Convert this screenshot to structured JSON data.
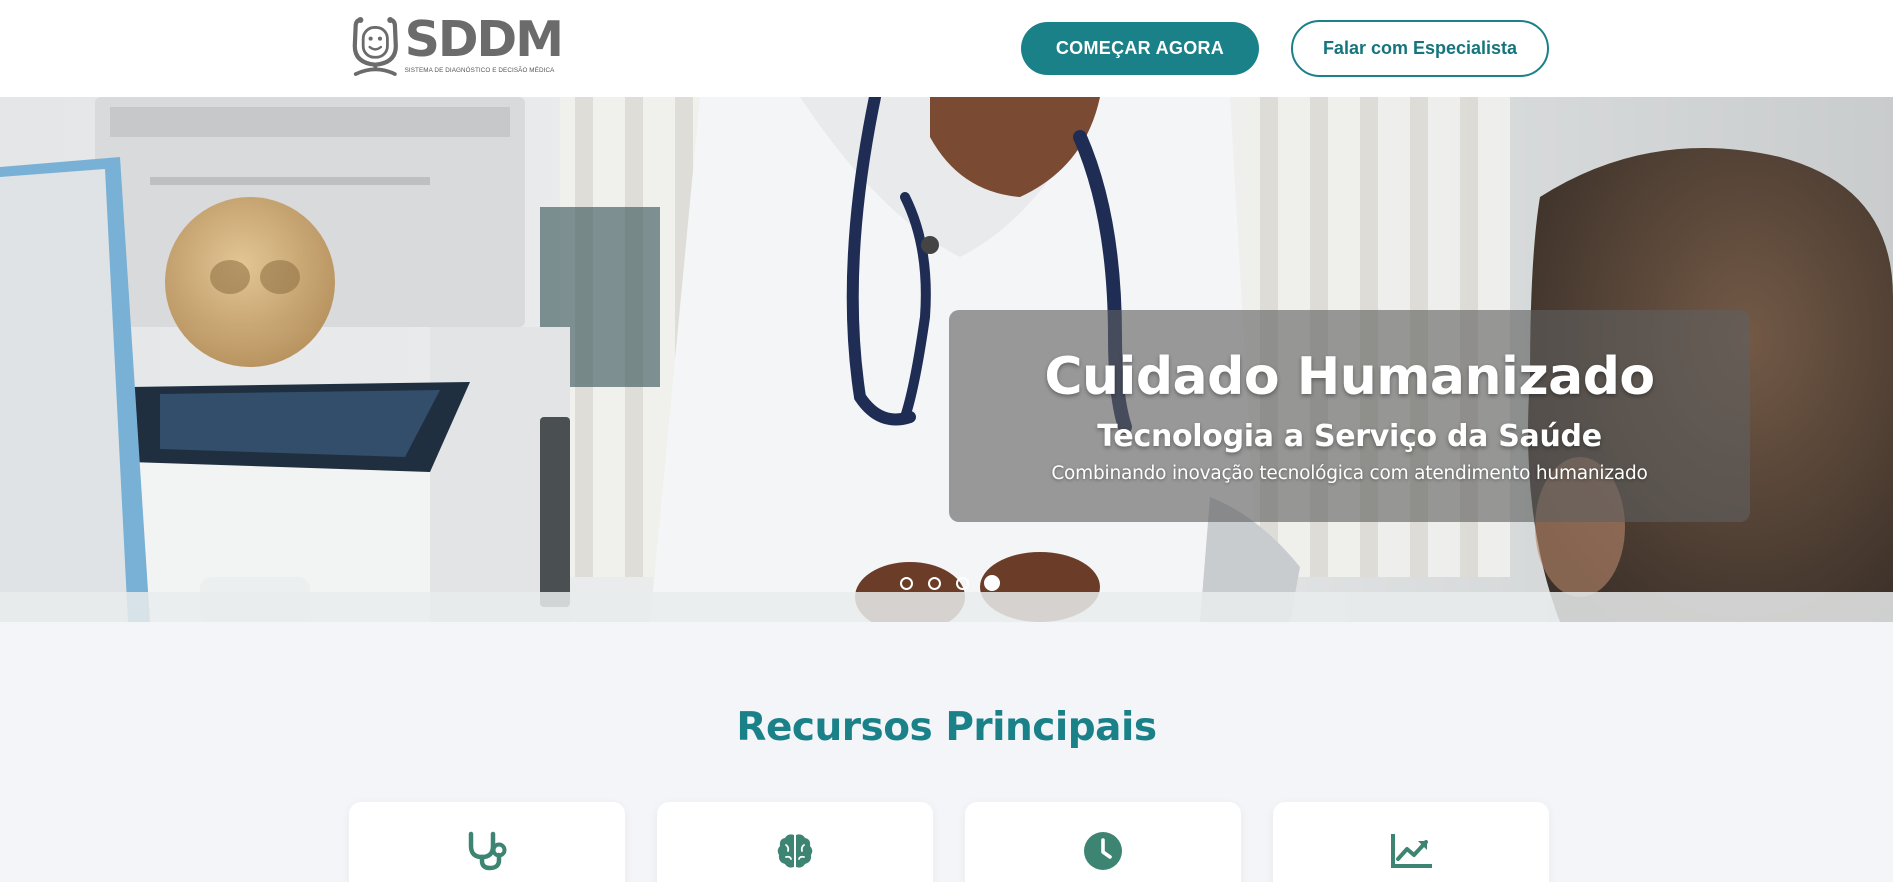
{
  "header": {
    "logo": {
      "name": "SDDM",
      "tagline": "SISTEMA DE DIAGNÓSTICO E DECISÃO MÉDICA"
    },
    "primary_cta": "COMEÇAR AGORA",
    "secondary_cta": "Falar com Especialista"
  },
  "hero": {
    "title": "Cuidado Humanizado",
    "subtitle": "Tecnologia a Serviço da Saúde",
    "description": "Combinando inovação tecnológica com atendimento humanizado",
    "slides_count": 4,
    "active_slide": 4
  },
  "features": {
    "title": "Recursos Principais",
    "cards": [
      {
        "icon": "stethoscope-icon"
      },
      {
        "icon": "brain-icon"
      },
      {
        "icon": "clock-icon"
      },
      {
        "icon": "chart-line-icon"
      }
    ]
  },
  "colors": {
    "accent": "#1a8189",
    "icon": "#3e8472",
    "background": "#f4f5f9"
  }
}
